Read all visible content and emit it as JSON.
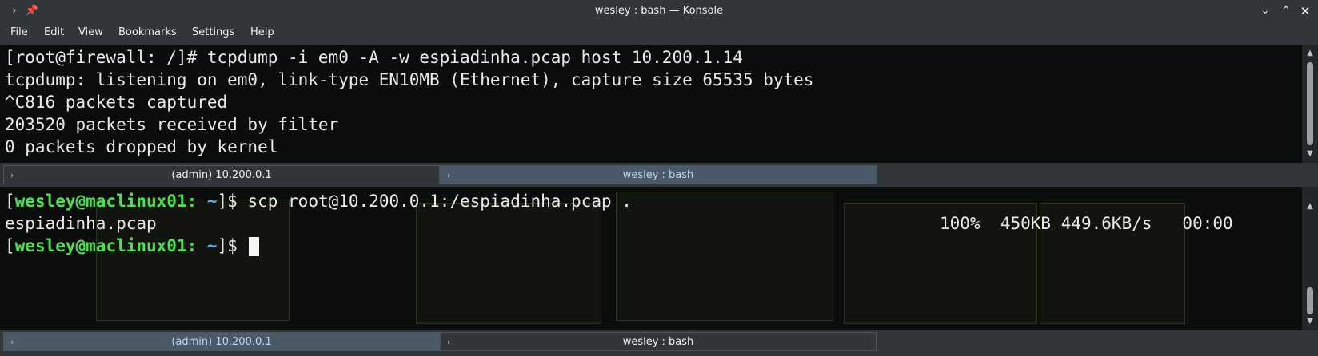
{
  "window": {
    "title": "wesley : bash — Konsole"
  },
  "menu": {
    "items": [
      "File",
      "Edit",
      "View",
      "Bookmarks",
      "Settings",
      "Help"
    ]
  },
  "top_terminal": {
    "lines": [
      "[root@firewall: /]# tcpdump -i em0 -A -w espiadinha.pcap host 10.200.1.14",
      "tcpdump: listening on em0, link-type EN10MB (Ethernet), capture size 65535 bytes",
      "^C816 packets captured",
      "203520 packets received by filter",
      "0 packets dropped by kernel"
    ]
  },
  "top_tabs": [
    {
      "label": "(admin) 10.200.0.1",
      "active": false
    },
    {
      "label": "wesley : bash",
      "active": true
    }
  ],
  "bottom_terminal": {
    "prompt_open": "[",
    "prompt_user": "wesley@maclinux01:",
    "prompt_dir": " ~",
    "prompt_close": "]$",
    "command": " scp root@10.200.0.1:/espiadinha.pcap .",
    "transfer_file": "espiadinha.pcap",
    "transfer_stats": "100%  450KB 449.6KB/s   00:00"
  },
  "bottom_tabs": [
    {
      "label": "(admin) 10.200.0.1",
      "active": true
    },
    {
      "label": "wesley : bash",
      "active": false
    }
  ]
}
